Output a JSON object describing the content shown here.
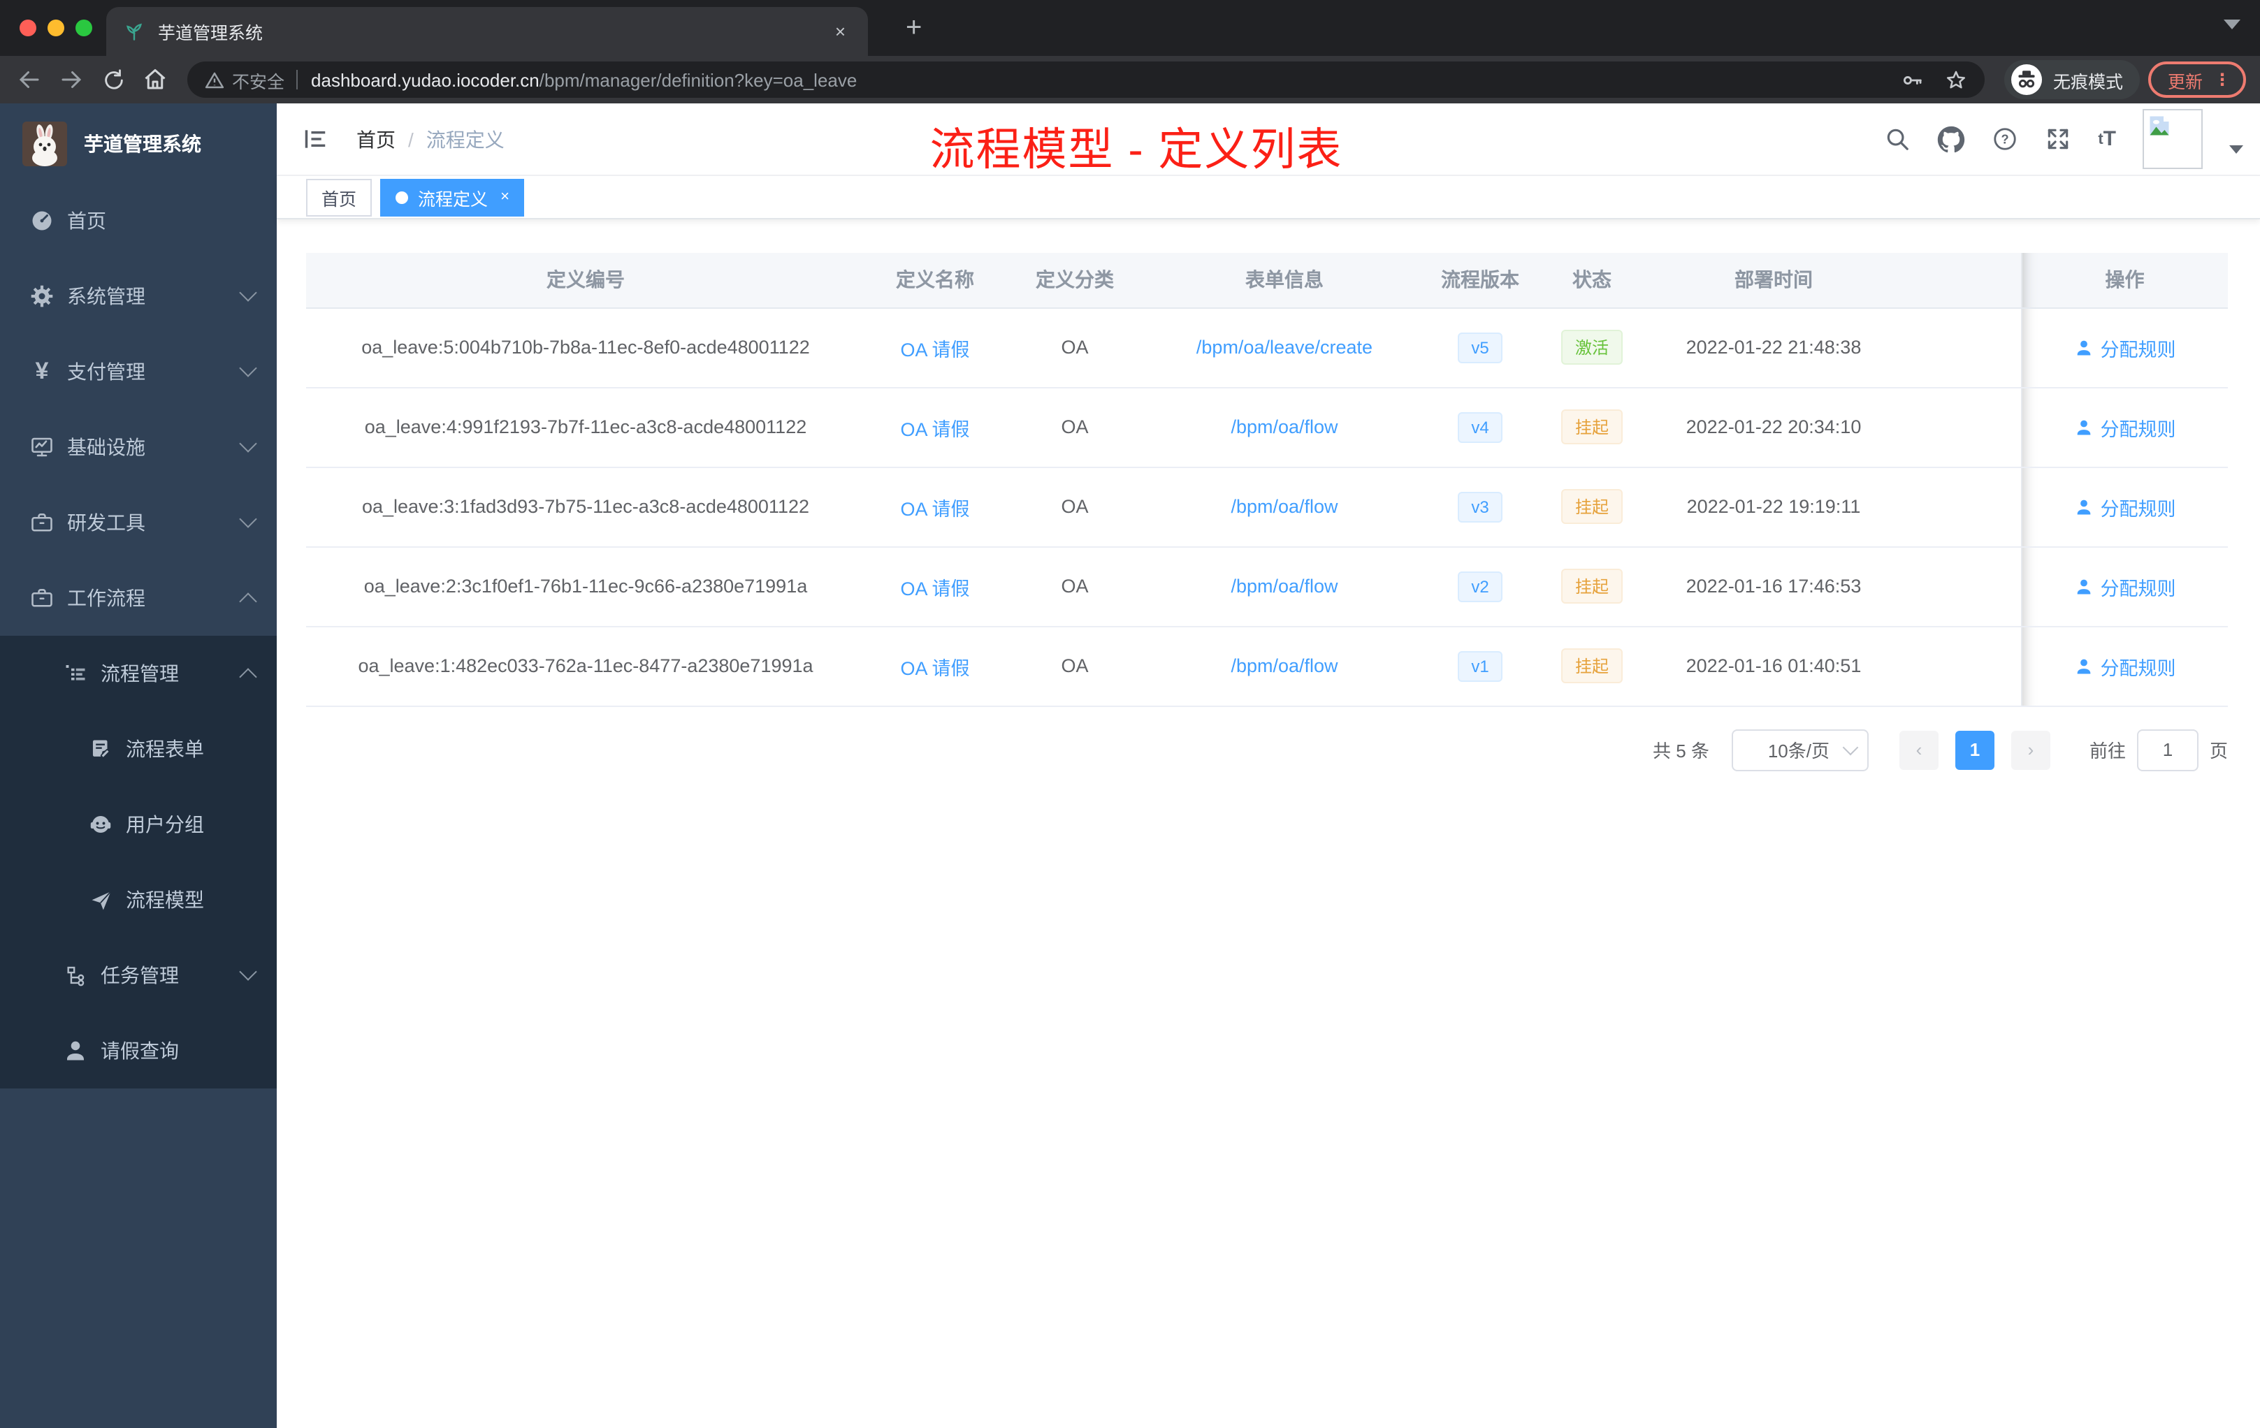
{
  "browser": {
    "tab_title": "芋道管理系统",
    "new_tab_label": "+",
    "close_label": "×",
    "address": {
      "security_text": "不安全",
      "host": "dashboard.yudao.iocoder.cn",
      "path": "/bpm/manager/definition?key=oa_leave"
    },
    "incognito_label": "无痕模式",
    "update_label": "更新",
    "icons": [
      "back-arrow",
      "forward-arrow",
      "reload",
      "home",
      "warning",
      "key",
      "star",
      "incognito",
      "kebab-menu"
    ]
  },
  "sidebar": {
    "title": "芋道管理系统",
    "items": [
      {
        "label": "首页",
        "icon": "dashboard"
      },
      {
        "label": "系统管理",
        "icon": "gear",
        "expand": "down"
      },
      {
        "label": "支付管理",
        "icon": "yen",
        "expand": "down"
      },
      {
        "label": "基础设施",
        "icon": "monitor",
        "expand": "down"
      },
      {
        "label": "研发工具",
        "icon": "briefcase",
        "expand": "down"
      },
      {
        "label": "工作流程",
        "icon": "briefcase",
        "expand": "up"
      },
      {
        "label": "流程管理",
        "icon": "list-tree",
        "expand": "up"
      },
      {
        "label": "流程表单",
        "icon": "document-edit"
      },
      {
        "label": "用户分组",
        "icon": "robot-face"
      },
      {
        "label": "流程模型",
        "icon": "paper-plane"
      },
      {
        "label": "任务管理",
        "icon": "flow-tree",
        "expand": "down"
      },
      {
        "label": "请假查询",
        "icon": "user"
      }
    ]
  },
  "header": {
    "breadcrumb": {
      "home": "首页",
      "separator": "/",
      "current": "流程定义"
    },
    "annotation": "流程模型 - 定义列表",
    "icons": [
      "search",
      "github",
      "help",
      "fullscreen",
      "font-size",
      "avatar",
      "caret-down"
    ]
  },
  "tags": {
    "home": "首页",
    "active": "流程定义",
    "active_close": "×"
  },
  "table": {
    "columns": [
      "定义编号",
      "定义名称",
      "定义分类",
      "表单信息",
      "流程版本",
      "状态",
      "部署时间",
      "操作"
    ],
    "rows": [
      {
        "id": "oa_leave:5:004b710b-7b8a-11ec-8ef0-acde48001122",
        "name": "OA 请假",
        "category": "OA",
        "form": "/bpm/oa/leave/create",
        "version": "v5",
        "status": "激活",
        "status_type": "success",
        "time": "2022-01-22 21:48:38",
        "action": "分配规则"
      },
      {
        "id": "oa_leave:4:991f2193-7b7f-11ec-a3c8-acde48001122",
        "name": "OA 请假",
        "category": "OA",
        "form": "/bpm/oa/flow",
        "version": "v4",
        "status": "挂起",
        "status_type": "warning",
        "time": "2022-01-22 20:34:10",
        "action": "分配规则"
      },
      {
        "id": "oa_leave:3:1fad3d93-7b75-11ec-a3c8-acde48001122",
        "name": "OA 请假",
        "category": "OA",
        "form": "/bpm/oa/flow",
        "version": "v3",
        "status": "挂起",
        "status_type": "warning",
        "time": "2022-01-22 19:19:11",
        "action": "分配规则"
      },
      {
        "id": "oa_leave:2:3c1f0ef1-76b1-11ec-9c66-a2380e71991a",
        "name": "OA 请假",
        "category": "OA",
        "form": "/bpm/oa/flow",
        "version": "v2",
        "status": "挂起",
        "status_type": "warning",
        "time": "2022-01-16 17:46:53",
        "action": "分配规则"
      },
      {
        "id": "oa_leave:1:482ec033-762a-11ec-8477-a2380e71991a",
        "name": "OA 请假",
        "category": "OA",
        "form": "/bpm/oa/flow",
        "version": "v1",
        "status": "挂起",
        "status_type": "warning",
        "time": "2022-01-16 01:40:51",
        "action": "分配规则"
      }
    ]
  },
  "pagination": {
    "total": "共 5 条",
    "page_size": "10条/页",
    "current_page": "1",
    "goto_label": "前往",
    "goto_value": "1",
    "goto_suffix": "页"
  },
  "colors": {
    "accent": "#409eff",
    "annotation_red": "#fb2016",
    "status_active_green": "#67c23a",
    "status_suspend_orange": "#e6a23c",
    "sidebar_bg": "#304156",
    "sidebar_submenu_bg": "#1f2d3d",
    "table_header_bg": "#f5f7fa"
  }
}
